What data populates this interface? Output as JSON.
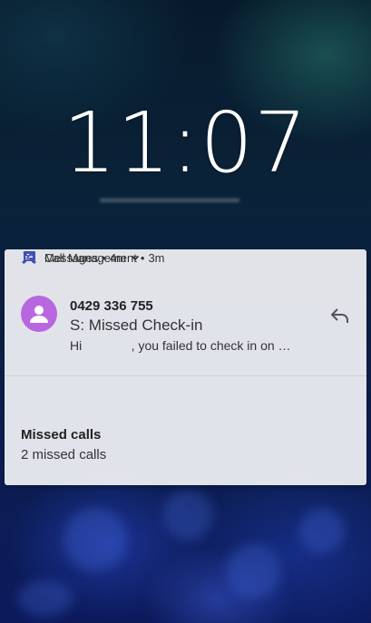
{
  "lockscreen": {
    "time": "11:07"
  },
  "notifications": [
    {
      "app": "Messages",
      "age": "4m",
      "icon": "messages-app-icon",
      "sender": "0429 336 755",
      "subject": "S: Missed Check-in",
      "snippet": "Hi              , you failed to check in on …",
      "avatar_color": "#b867e0",
      "action_icon": "reply-icon"
    },
    {
      "app": "Call Management",
      "age": "3m",
      "icon": "missed-call-icon",
      "title": "Missed calls",
      "text": "2 missed calls"
    }
  ],
  "colors": {
    "accent": "#3f51b5",
    "avatar": "#b867e0",
    "panel": "#f2f2f6"
  }
}
